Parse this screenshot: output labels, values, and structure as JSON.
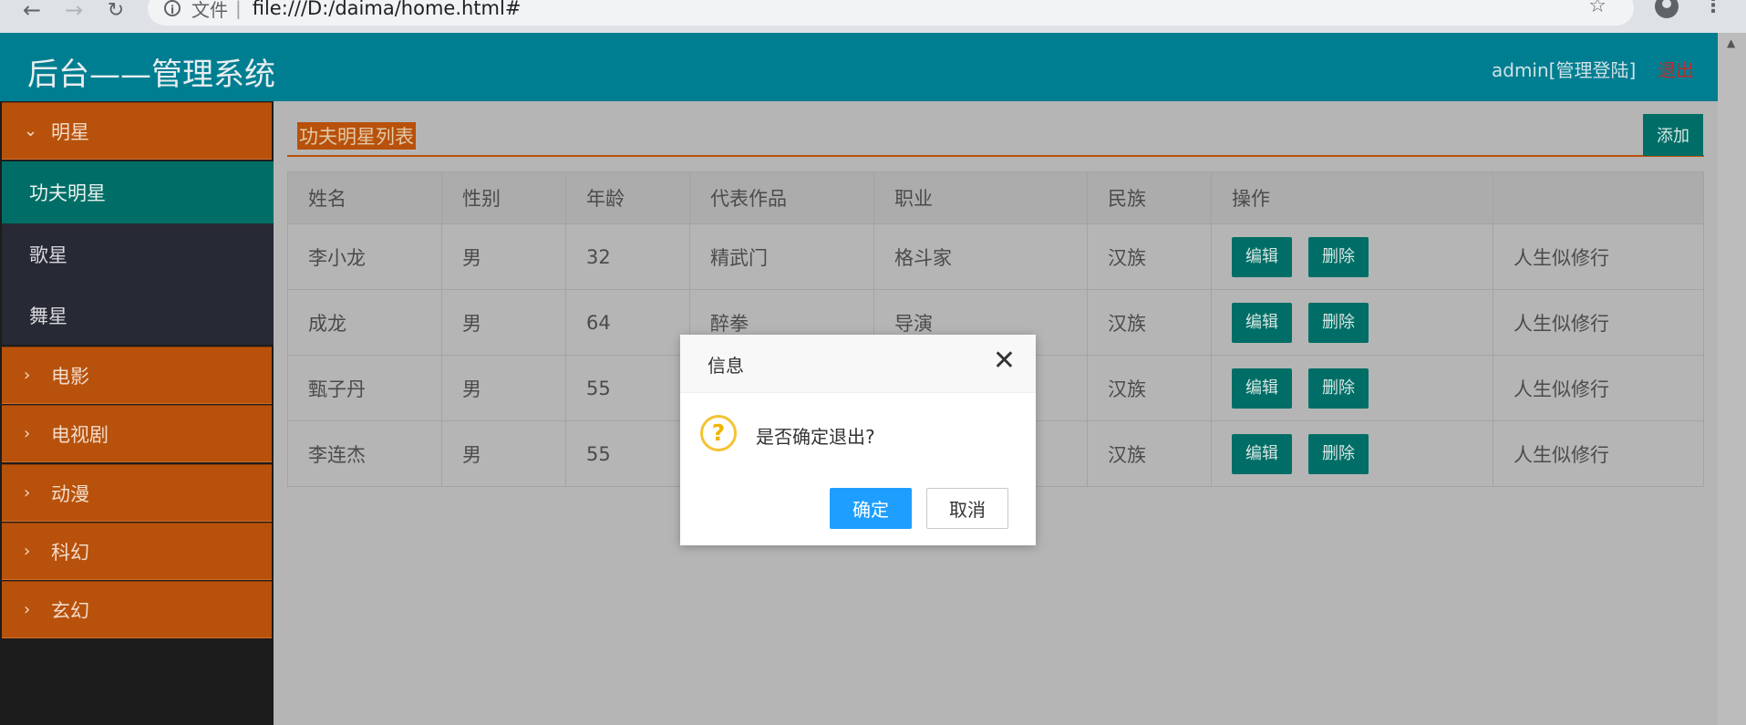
{
  "browser": {
    "scheme_label": "文件",
    "url": "file:///D:/daima/home.html#"
  },
  "header": {
    "title": "后台——管理系统",
    "user": "admin[管理登陆]",
    "logout": "退出"
  },
  "sidebar": {
    "expanded_group": "明星",
    "sub_items": [
      "功夫明星",
      "歌星",
      "舞星"
    ],
    "groups": [
      "电影",
      "电视剧",
      "动漫",
      "科幻",
      "玄幻"
    ]
  },
  "main": {
    "heading": "功夫明星列表",
    "add_label": "添加",
    "columns": [
      "姓名",
      "性别",
      "年龄",
      "代表作品",
      "职业",
      "民族",
      "操作",
      ""
    ],
    "rows": [
      [
        "李小龙",
        "男",
        "32",
        "精武门",
        "格斗家",
        "汉族",
        "人生似修行"
      ],
      [
        "成龙",
        "男",
        "64",
        "醉拳",
        "导演",
        "汉族",
        "人生似修行"
      ],
      [
        "甄子丹",
        "男",
        "55",
        "",
        "",
        "汉族",
        "人生似修行"
      ],
      [
        "李连杰",
        "男",
        "55",
        "",
        "",
        "汉族",
        "人生似修行"
      ]
    ],
    "edit_label": "编辑",
    "delete_label": "删除"
  },
  "dialog": {
    "title": "信息",
    "message": "是否确定退出?",
    "ok": "确定",
    "cancel": "取消"
  },
  "colors": {
    "header": "#007e91",
    "menu": "#b8510b",
    "accent": "#006e66",
    "primary_button": "#1e9fff"
  }
}
